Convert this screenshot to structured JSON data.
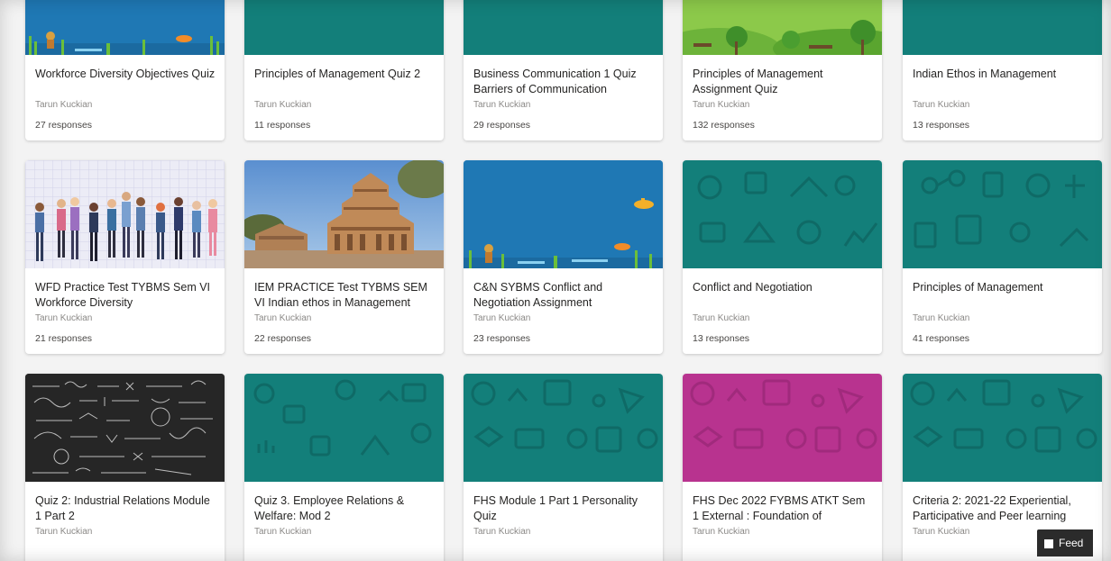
{
  "colors": {
    "teal": "#137f7a",
    "magenta": "#b8338f",
    "ocean": "#1f78b4",
    "background": "#f3f3f3"
  },
  "rows": [
    {
      "cards": [
        {
          "title": "Workforce Diversity Objectives Quiz",
          "author": "Tarun Kuckian",
          "responses": "27 responses",
          "thumbnail": "ocean-scene"
        },
        {
          "title": "Principles of Management Quiz 2",
          "author": "Tarun Kuckian",
          "responses": "11 responses",
          "thumbnail": "teal-pattern"
        },
        {
          "title": "Business Communication 1 Quiz Barriers of Communication",
          "author": "Tarun Kuckian",
          "responses": "29 responses",
          "thumbnail": "teal-pattern"
        },
        {
          "title": "Principles of Management Assignment Quiz",
          "author": "Tarun Kuckian",
          "responses": "132 responses",
          "thumbnail": "park-scene"
        },
        {
          "title": "Indian Ethos in Management",
          "author": "Tarun Kuckian",
          "responses": "13 responses",
          "thumbnail": "teal-pattern"
        }
      ]
    },
    {
      "cards": [
        {
          "title": "WFD Practice Test TYBMS Sem VI Workforce Diversity",
          "author": "Tarun Kuckian",
          "responses": "21 responses",
          "thumbnail": "people-illustration"
        },
        {
          "title": "IEM PRACTICE Test TYBMS SEM VI Indian ethos in Management",
          "author": "Tarun Kuckian",
          "responses": "22 responses",
          "thumbnail": "temple-photo"
        },
        {
          "title": "C&N SYBMS Conflict and Negotiation Assignment",
          "author": "Tarun Kuckian",
          "responses": "23 responses",
          "thumbnail": "ocean-scene"
        },
        {
          "title": "Conflict and Negotiation",
          "author": "Tarun Kuckian",
          "responses": "13 responses",
          "thumbnail": "teal-pattern"
        },
        {
          "title": "Principles of Management",
          "author": "Tarun Kuckian",
          "responses": "41 responses",
          "thumbnail": "teal-pattern"
        }
      ]
    },
    {
      "cards": [
        {
          "title": "Quiz 2: Industrial Relations Module 1 Part 2",
          "author": "Tarun Kuckian",
          "responses": "",
          "thumbnail": "chalkboard-photo"
        },
        {
          "title": "Quiz 3. Employee Relations & Welfare: Mod 2",
          "author": "Tarun Kuckian",
          "responses": "",
          "thumbnail": "teal-pattern"
        },
        {
          "title": "FHS Module 1 Part 1 Personality Quiz",
          "author": "Tarun Kuckian",
          "responses": "",
          "thumbnail": "teal-pattern"
        },
        {
          "title": "FHS Dec 2022 FYBMS ATKT Sem 1 External : Foundation of",
          "author": "Tarun Kuckian",
          "responses": "",
          "thumbnail": "magenta-pattern"
        },
        {
          "title": "Criteria 2: 2021-22 Experiential, Participative and Peer learning",
          "author": "Tarun Kuckian",
          "responses": "",
          "thumbnail": "teal-pattern"
        }
      ]
    }
  ],
  "feedback_button": {
    "label": "Feed"
  }
}
